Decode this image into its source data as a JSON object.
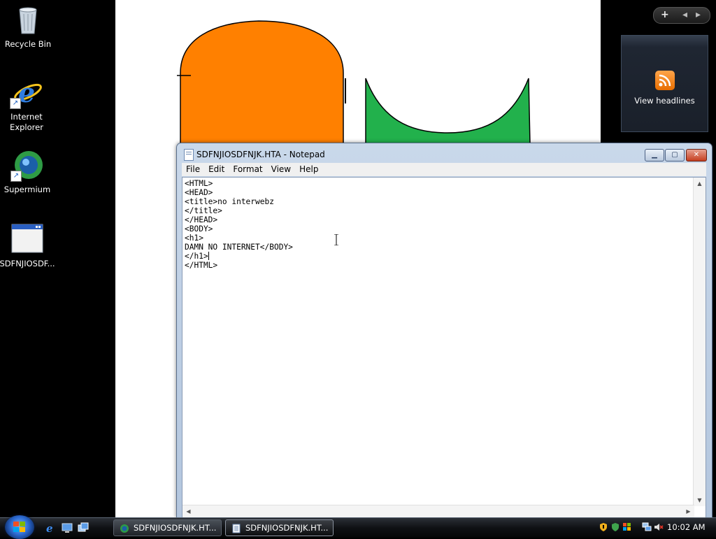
{
  "desktop": {
    "icons": [
      {
        "label": "Recycle Bin"
      },
      {
        "label": "Internet\nExplorer"
      },
      {
        "label": "Supermium"
      },
      {
        "label": "SDFNJIOSDF..."
      }
    ]
  },
  "sidebar": {
    "controls": {
      "add": "+",
      "prev": "◂",
      "next": "▸"
    },
    "gadget": {
      "label": "View headlines",
      "icon": "rss-feed-icon"
    }
  },
  "notepad": {
    "title": "SDFNJIOSDFNJK.HTA - Notepad",
    "menu": [
      "File",
      "Edit",
      "Format",
      "View",
      "Help"
    ],
    "content_lines": [
      "<HTML>",
      "<HEAD>",
      "<title>no interwebz",
      "</title>",
      "</HEAD>",
      "<BODY>",
      "<h1>",
      "DAMN NO INTERNET</BODY>",
      "</h1>",
      "</HTML>"
    ],
    "colors": {
      "title_grad_top": "#c9d8ea",
      "close_red": "#c63e1f"
    }
  },
  "taskbar": {
    "tasks": [
      {
        "label": "SDFNJIOSDFNJK.HT...",
        "active": false,
        "icon": "supermium-icon"
      },
      {
        "label": "SDFNJIOSDFNJK.HT...",
        "active": true,
        "icon": "notepad-icon"
      }
    ],
    "clock": "10:02 AM"
  },
  "background_shapes": {
    "orange": "#ff8000",
    "green": "#22b14c"
  }
}
